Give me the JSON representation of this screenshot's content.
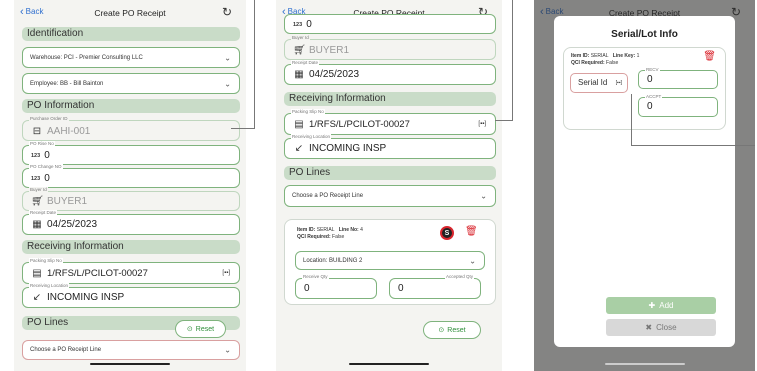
{
  "header": {
    "back_label": "Back",
    "title": "Create PO Receipt"
  },
  "identification": {
    "title": "Identification",
    "warehouse": "Warehouse: PCI - Premier Consulting LLC",
    "employee": "Employee: BB - Bill Bainton"
  },
  "po_info": {
    "title": "PO Information",
    "purchase_order_label": "Purchase Order ID",
    "purchase_order_value": "AAHI-001",
    "po_rise_label": "PO Rise No",
    "po_rise_value": "0",
    "po_change_label": "PO Change NO",
    "po_change_value": "0",
    "buyer_label": "Buyer Id",
    "buyer_value": "BUYER1",
    "receipt_date_label": "Receipt Date",
    "receipt_date_value": "04/25/2023"
  },
  "receiving": {
    "title": "Receiving Information",
    "packing_slip_label": "Packing Slip No",
    "packing_slip_value": "1/RFS/L/PCILOT-00027",
    "location_label": "Receiving Location",
    "location_value": "INCOMING INSP"
  },
  "po_lines": {
    "title": "PO Lines",
    "select_placeholder": "Choose a PO Receipt Line",
    "reset_label": "Reset",
    "item": {
      "item_id_label": "Item ID:",
      "item_id_value": "SERIAL",
      "line_no_label": "Line No:",
      "line_no_value": "4",
      "qci_label": "QCI Required:",
      "qci_value": "False",
      "location": "Location: BUILDING 2",
      "receive_qty_label": "Receive Qty",
      "receive_qty_value": "0",
      "accepted_qty_label": "Accepted Qty",
      "accepted_qty_value": "0",
      "serial_badge": "S"
    }
  },
  "modal": {
    "title": "Serial/Lot Info",
    "item_id_label": "Item ID:",
    "item_id_value": "SERIAL",
    "line_key_label": "Line Key:",
    "line_key_value": "1",
    "qci_label": "QCI Required:",
    "qci_value": "False",
    "serial_placeholder": "Serial Id",
    "recv_label": "RECV",
    "recv_value": "0",
    "accpt_label": "ACCPT",
    "accpt_value": "0",
    "add_label": "Add",
    "close_label": "Close"
  },
  "icons": {
    "number_prefix": "123",
    "qr_glyph": "[▪▪]"
  },
  "colors": {
    "accent_green": "#7fb37d",
    "section_green": "#c9dcc8",
    "link_blue": "#2f6fcf",
    "danger_red": "#d9262e"
  }
}
